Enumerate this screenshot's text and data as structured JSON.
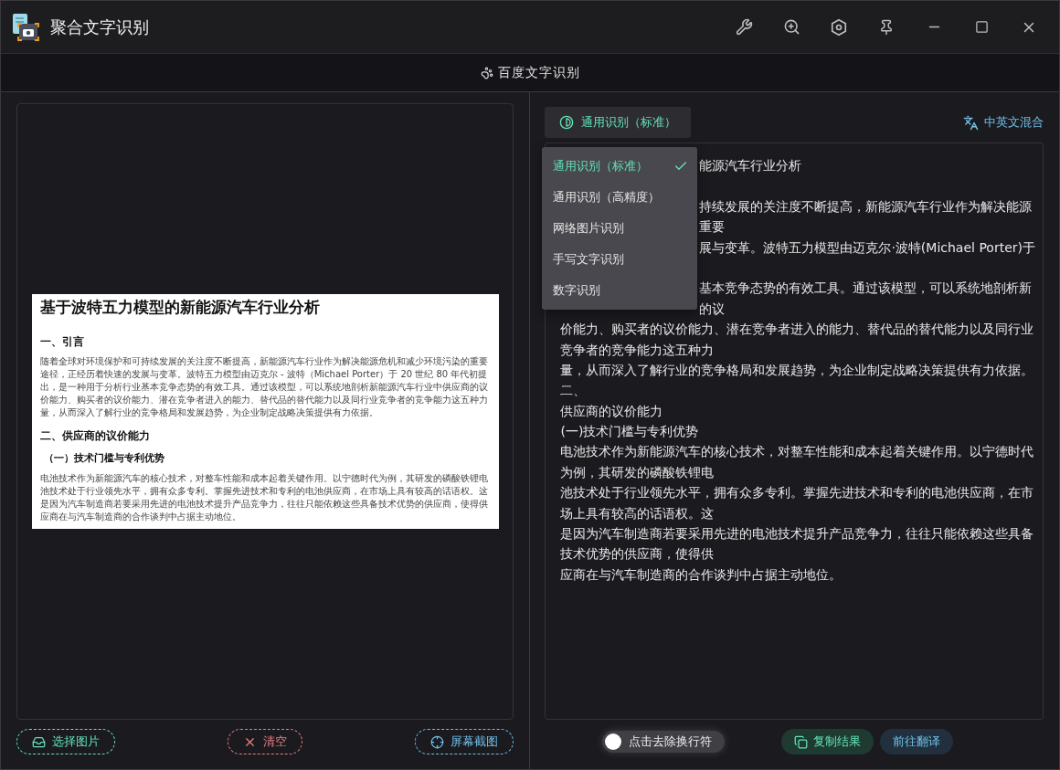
{
  "window": {
    "title": "聚合文字识别"
  },
  "subheader": {
    "title": "百度文字识别"
  },
  "document": {
    "title": "基于波特五力模型的新能源汽车行业分析",
    "sections": [
      {
        "kind": "heading",
        "text": "一、引言"
      },
      {
        "kind": "paragraph",
        "text": "随着全球对环境保护和可持续发展的关注度不断提高，新能源汽车行业作为解决能源危机和减少环境污染的重要途径，正经历着快速的发展与变革。波特五力模型由迈克尔 - 波特（Michael Porter）于 20 世纪 80 年代初提出，是一种用于分析行业基本竞争态势的有效工具。通过该模型，可以系统地剖析新能源汽车行业中供应商的议价能力、购买者的议价能力、潜在竞争者进入的能力、替代品的替代能力以及同行业竞争者的竞争能力这五种力量，从而深入了解行业的竞争格局和发展趋势，为企业制定战略决策提供有力依据。"
      },
      {
        "kind": "heading",
        "text": "二、供应商的议价能力"
      },
      {
        "kind": "subheading",
        "text": "（一）技术门槛与专利优势"
      },
      {
        "kind": "paragraph",
        "text": "电池技术作为新能源汽车的核心技术，对整车性能和成本起着关键作用。以宁德时代为例，其研发的磷酸铁锂电池技术处于行业领先水平，拥有众多专利。掌握先进技术和专利的电池供应商，在市场上具有较高的话语权。这是因为汽车制造商若要采用先进的电池技术提升产品竞争力，往往只能依赖这些具备技术优势的供应商，使得供应商在与汽车制造商的合作谈判中占据主动地位。"
      }
    ]
  },
  "left_actions": [
    {
      "kind": "select",
      "label": "选择图片"
    },
    {
      "kind": "clear",
      "label": "清空"
    },
    {
      "kind": "capture",
      "label": "屏幕截图"
    }
  ],
  "mode_button": {
    "label": "通用识别（标准）"
  },
  "language": {
    "label": "中英文混合"
  },
  "mode_menu": [
    {
      "label": "通用识别（标准）",
      "selected": true
    },
    {
      "label": "通用识别（高精度）",
      "selected": false
    },
    {
      "label": "网络图片识别",
      "selected": false
    },
    {
      "label": "手写文字识别",
      "selected": false
    },
    {
      "label": "数字识别",
      "selected": false
    }
  ],
  "result_lines": [
    {
      "kind": "covered",
      "text": "能源汽车行业分析"
    },
    {
      "kind": "hidden"
    },
    {
      "kind": "covered",
      "text": "持续发展的关注度不断提高，新能源汽车行业作为解决能源"
    },
    {
      "kind": "covered",
      "text": "重要"
    },
    {
      "kind": "covered",
      "text": "展与变革。波特五力模型由迈克尔·波特(Michael Porter)于"
    },
    {
      "kind": "hidden"
    },
    {
      "kind": "covered",
      "text": "基本竞争态势的有效工具。通过该模型，可以系统地剖析新"
    },
    {
      "kind": "covered",
      "text": "的议"
    },
    {
      "kind": "full",
      "text": "价能力、购买者的议价能力、潜在竞争者进入的能力、替代品的替代能力以及同行业"
    },
    {
      "kind": "full",
      "text": "竞争者的竞争能力这五种力"
    },
    {
      "kind": "full",
      "text": "量，从而深入了解行业的竞争格局和发展趋势，为企业制定战略决策提供有力依据。"
    },
    {
      "kind": "full",
      "text": "二、"
    },
    {
      "kind": "full",
      "text": "供应商的议价能力"
    },
    {
      "kind": "full",
      "text": "(一)技术门槛与专利优势"
    },
    {
      "kind": "full",
      "text": "电池技术作为新能源汽车的核心技术，对整车性能和成本起着关键作用。以宁德时代"
    },
    {
      "kind": "full",
      "text": "为例，其研发的磷酸铁锂电"
    },
    {
      "kind": "full",
      "text": "池技术处于行业领先水平，拥有众多专利。掌握先进技术和专利的电池供应商，在市"
    },
    {
      "kind": "full",
      "text": "场上具有较高的话语权。这"
    },
    {
      "kind": "full",
      "text": "是因为汽车制造商若要采用先进的电池技术提升产品竞争力，往往只能依赖这些具备"
    },
    {
      "kind": "full",
      "text": "技术优势的供应商，使得供"
    },
    {
      "kind": "full",
      "text": "应商在与汽车制造商的合作谈判中占据主动地位。"
    }
  ],
  "line_break_toggle": {
    "label": "点击去除换行符",
    "on": false
  },
  "right_actions": [
    {
      "kind": "copy",
      "label": "复制结果"
    },
    {
      "kind": "translate",
      "label": "前往翻译"
    }
  ]
}
